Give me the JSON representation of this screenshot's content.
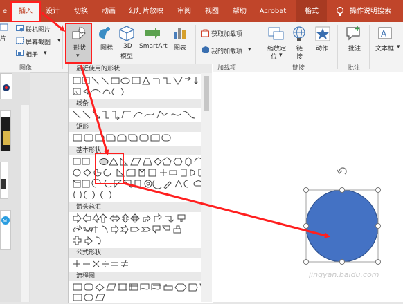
{
  "tabs": {
    "file_partial": "e",
    "insert": "插入",
    "design": "设计",
    "transitions": "切换",
    "animations": "动画",
    "slideshow": "幻灯片放映",
    "review": "审阅",
    "view": "视图",
    "help": "帮助",
    "acrobat": "Acrobat",
    "format": "格式",
    "tell_me": "操作说明搜索"
  },
  "ribbon": {
    "picture_partial": "片",
    "online_picture": "联机图片",
    "screenshot": "屏幕截图",
    "album": "相册",
    "group_images": "图像",
    "shapes": "形状",
    "icons": "图标",
    "model3d_line1": "3D",
    "model3d_line2": "模型",
    "smartart": "SmartArt",
    "chart": "图表",
    "get_addins": "获取加载项",
    "my_addins": "我的加载项",
    "group_addins": "加载项",
    "zoom_line1": "缩放定",
    "zoom_line2": "位",
    "link_line1": "链",
    "link_line2": "接",
    "action": "动作",
    "group_links": "链接",
    "comment": "批注",
    "group_comments": "批注",
    "textbox": "文本框",
    "chevron": "▾"
  },
  "dropdown": {
    "recent": "最近使用的形状",
    "lines": "线条",
    "rectangles": "矩形",
    "basic": "基本形状",
    "arrows": "箭头总汇",
    "equation": "公式形状",
    "flowchart": "流程图"
  },
  "watermark": "jingyan.baidu.com",
  "colors": {
    "accent": "#c0452a",
    "highlight": "#ff1f1f",
    "shape_fill": "#4472c4",
    "shape_stroke": "#2f528f"
  }
}
